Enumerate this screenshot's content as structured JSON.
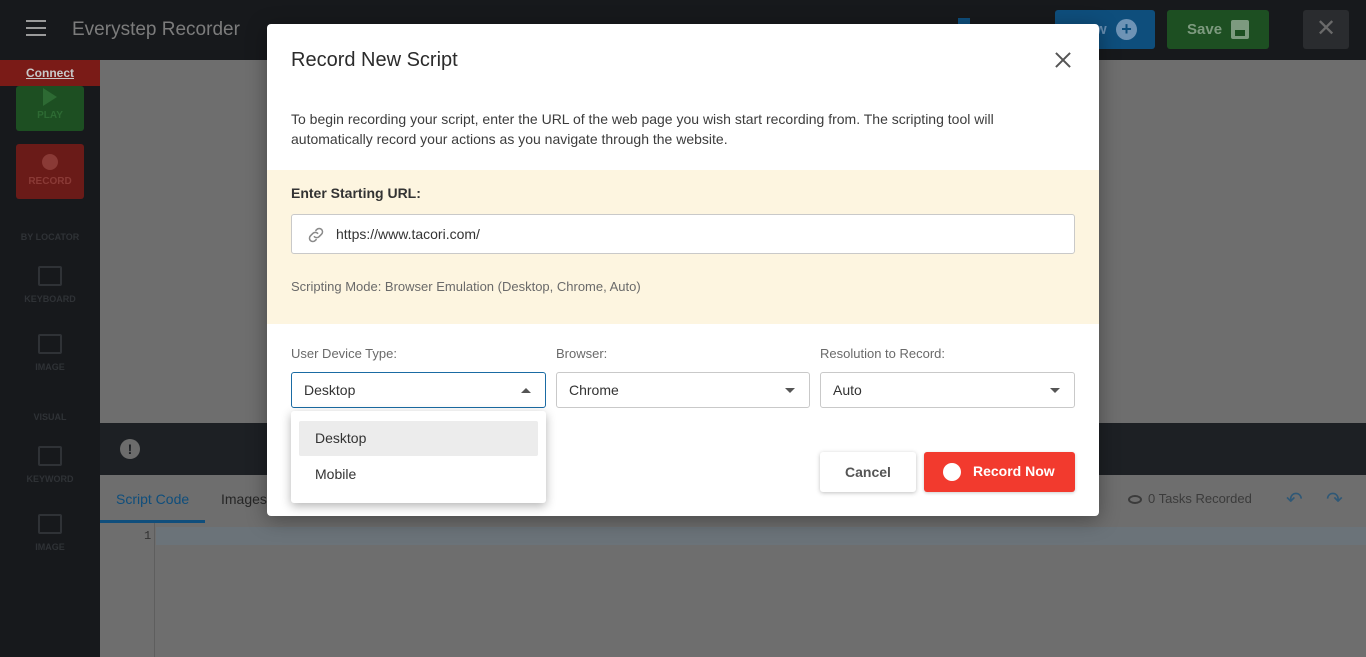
{
  "app": {
    "title": "Everystep Recorder",
    "new_label": "w",
    "save_label": "Save",
    "connect_label": "Connect",
    "sidebar": {
      "play_label": "PLAY",
      "record_label": "RECORD",
      "section1": "BY LOCATOR",
      "keyboard_label": "KEYBOARD",
      "image_label": "IMAGE",
      "section2": "VISUAL",
      "keyword_label": "KEYWORD",
      "image2_label": "IMAGE"
    },
    "tabs": [
      "Script Code",
      "Images"
    ],
    "tasks_recorded": "0 Tasks Recorded",
    "line_number": "1"
  },
  "modal": {
    "title": "Record New Script",
    "intro": "To begin recording your script, enter the URL of the web page you wish start recording from. The scripting tool will automatically record your actions as you navigate through the website.",
    "url_label": "Enter Starting URL:",
    "url_value": "https://www.tacori.com/",
    "mode_text": "Scripting Mode: Browser Emulation (Desktop, Chrome, Auto)",
    "device_label": "User Device Type:",
    "device_value": "Desktop",
    "device_options": [
      "Desktop",
      "Mobile"
    ],
    "browser_label": "Browser:",
    "browser_value": "Chrome",
    "resolution_label": "Resolution to Record:",
    "resolution_value": "Auto",
    "cancel_label": "Cancel",
    "record_label": "Record Now"
  }
}
